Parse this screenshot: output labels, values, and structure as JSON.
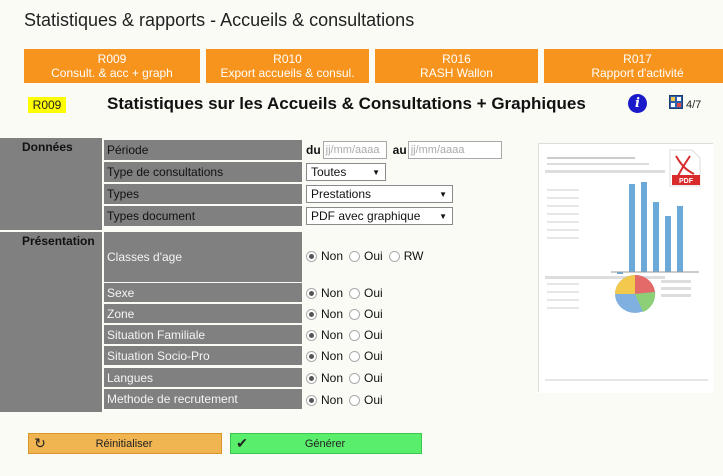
{
  "page_title": "Statistiques & rapports - Accueils & consultations",
  "tabs": [
    {
      "code": "R009",
      "label": "Consult. & acc + graph"
    },
    {
      "code": "R010",
      "label": "Export accueils & consul."
    },
    {
      "code": "R016",
      "label": "RASH Wallon"
    },
    {
      "code": "R017",
      "label": "Rapport d'activité"
    }
  ],
  "report": {
    "code": "R009",
    "heading": "Statistiques sur les Accueils & Consultations + Graphiques",
    "pages": "4/7"
  },
  "sections": {
    "data": "Données",
    "presentation": "Présentation"
  },
  "period": {
    "label": "Période",
    "from_label": "du",
    "to_label": "au",
    "from_placeholder": "jj/mm/aaaa",
    "to_placeholder": "jj/mm/aaaa"
  },
  "selects": [
    {
      "label": "Type de consultations",
      "value": "Toutes"
    },
    {
      "label": "Types",
      "value": "Prestations"
    },
    {
      "label": "Types document",
      "value": "PDF avec graphique"
    }
  ],
  "age_classes": {
    "label": "Classes d'age",
    "options": [
      "Non",
      "Oui",
      "RW"
    ],
    "selected": "Non"
  },
  "toggles": [
    {
      "label": "Sexe",
      "options": [
        "Non",
        "Oui"
      ],
      "selected": "Non"
    },
    {
      "label": "Zone",
      "options": [
        "Non",
        "Oui"
      ],
      "selected": "Non"
    },
    {
      "label": "Situation Familiale",
      "options": [
        "Non",
        "Oui"
      ],
      "selected": "Non"
    },
    {
      "label": "Situation Socio-Pro",
      "options": [
        "Non",
        "Oui"
      ],
      "selected": "Non"
    },
    {
      "label": "Langues",
      "options": [
        "Non",
        "Oui"
      ],
      "selected": "Non"
    },
    {
      "label": "Methode de recrutement",
      "options": [
        "Non",
        "Oui"
      ],
      "selected": "Non"
    }
  ],
  "buttons": {
    "reset": "Réinitialiser",
    "generate": "Générer"
  },
  "preview": {
    "pdf_badge": "PDF"
  },
  "colors": {
    "tab": "#f7941d",
    "badge": "#ffff00",
    "label_bg": "#808080",
    "reset": "#f0b450",
    "generate": "#59ee6c"
  }
}
